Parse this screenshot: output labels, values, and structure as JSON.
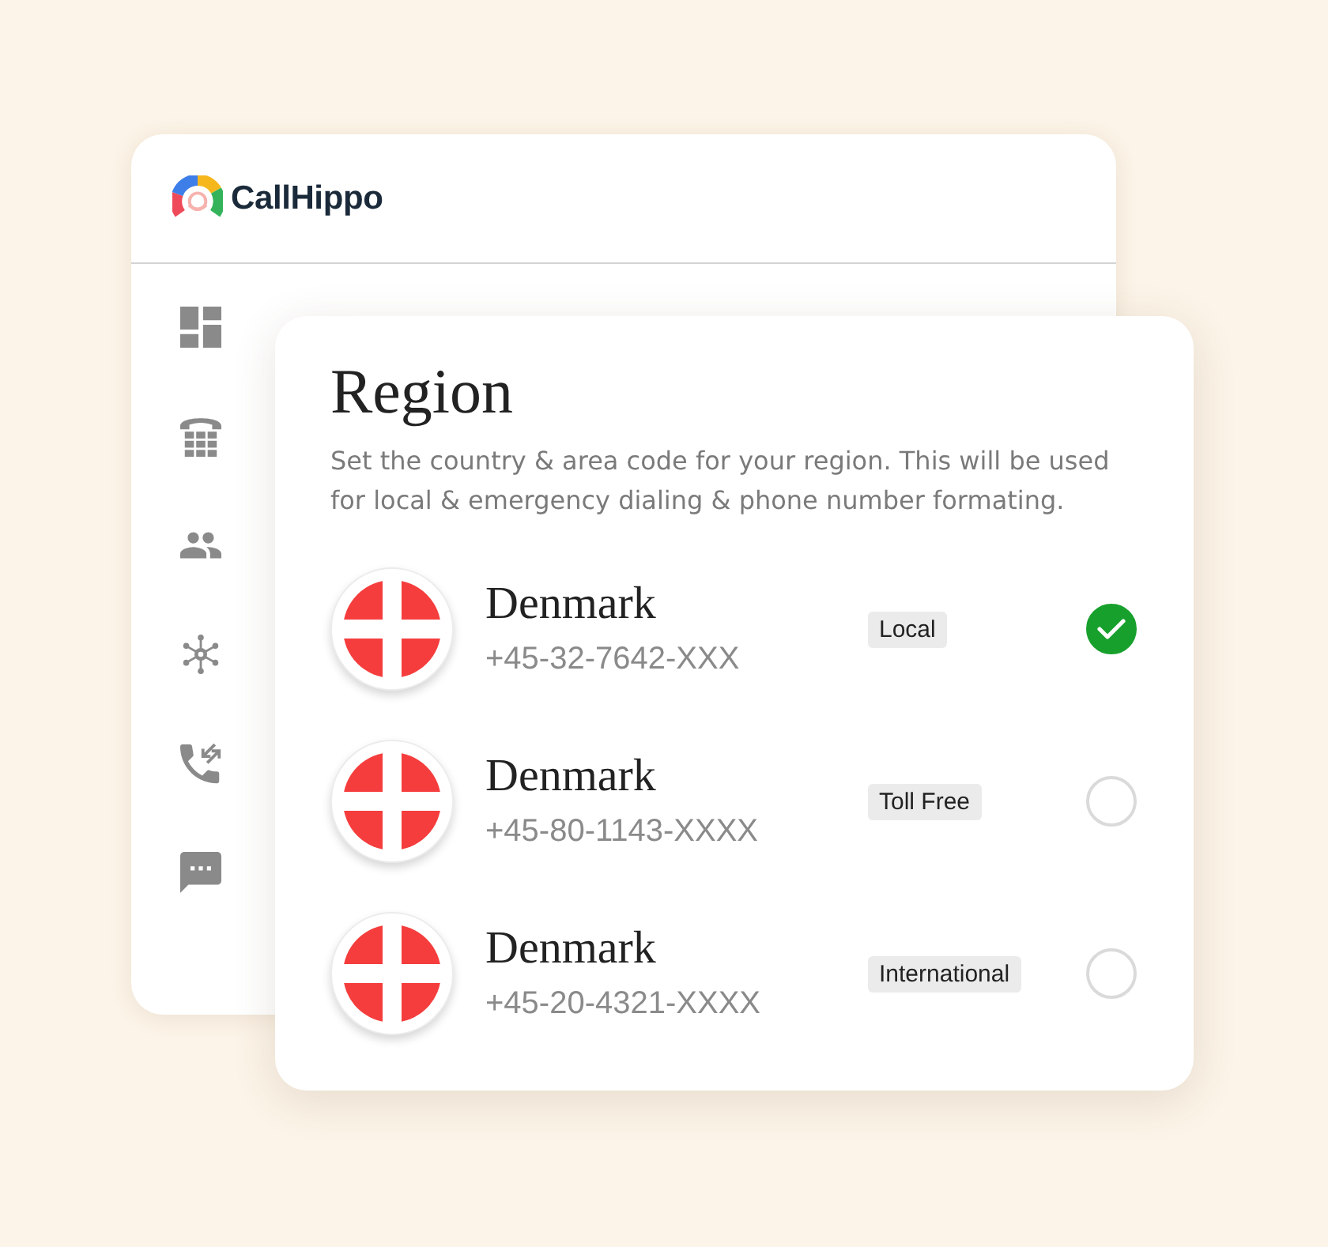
{
  "app": {
    "brand": "CallHippo"
  },
  "region": {
    "title": "Region",
    "description": "Set the country & area code for your region. This will be used for local & emergency dialing & phone number formating.",
    "rows": [
      {
        "country": "Denmark",
        "number": "+45-32-7642-XXX",
        "type": "Local",
        "selected": true
      },
      {
        "country": "Denmark",
        "number": "+45-80-1143-XXXX",
        "type": "Toll Free",
        "selected": false
      },
      {
        "country": "Denmark",
        "number": "+45-20-4321-XXXX",
        "type": "International",
        "selected": false
      }
    ]
  }
}
